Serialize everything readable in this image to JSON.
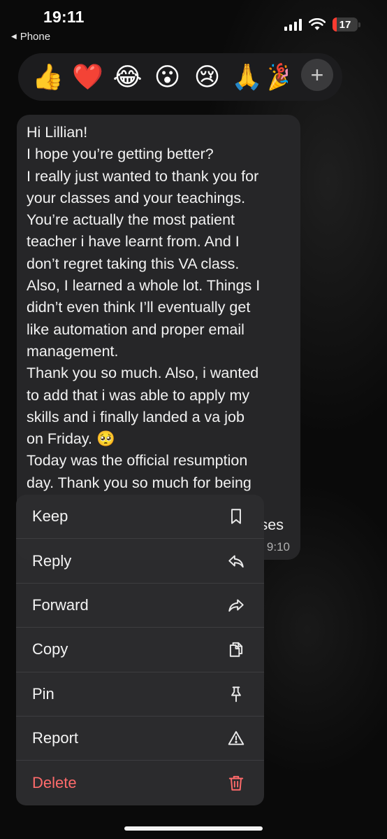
{
  "status_bar": {
    "time": "19:11",
    "back_label": "Phone",
    "battery_level": "17"
  },
  "reactions": {
    "emojis": [
      "👍",
      "❤️",
      "😂",
      "😮",
      "😢",
      "🙏",
      "🎉"
    ],
    "icon_names": [
      "thumbs-up-icon",
      "heart-icon",
      "laughing-icon",
      "surprised-icon",
      "crying-icon",
      "pray-icon",
      "party-icon"
    ],
    "more_label": "+"
  },
  "message": {
    "text": "Hi Lillian!\nI hope you’re getting better?\nI really just wanted to thank you for\nyour classes and your teachings.\nYou’re actually the most patient\nteacher i have learnt from. And I\ndon’t regret taking this VA class.\nAlso, I learned a whole lot. Things I\ndidn’t even think I’ll eventually get\nlike automation and proper email\nmanagement.\nThank you so much. Also, i wanted\nto add that i was able to apply my\nskills and i finally landed a va job\non Friday. 🥺\nToday was the official resumption\nday. Thank you so much for being",
    "hidden_word_fragment": "ses",
    "time_fragment": "9:10"
  },
  "menu": {
    "items": [
      {
        "label": "Keep",
        "icon": "bookmark-icon"
      },
      {
        "label": "Reply",
        "icon": "reply-icon"
      },
      {
        "label": "Forward",
        "icon": "forward-icon"
      },
      {
        "label": "Copy",
        "icon": "copy-icon"
      },
      {
        "label": "Pin",
        "icon": "pin-icon"
      },
      {
        "label": "Report",
        "icon": "warning-icon"
      },
      {
        "label": "Delete",
        "icon": "trash-icon"
      }
    ]
  },
  "colors": {
    "background": "#0b0b0b",
    "bubble": "#262628",
    "menu": "#2c2c2e",
    "danger": "#ff6b6b",
    "battery_low": "#ff3b30"
  }
}
